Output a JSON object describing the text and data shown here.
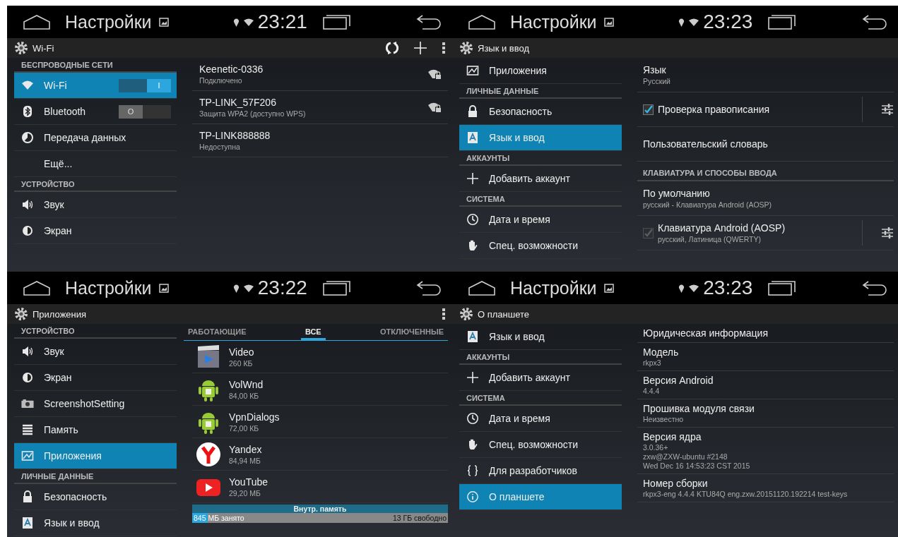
{
  "panels": [
    {
      "status_bar": {
        "title": "Настройки",
        "time": "23:21"
      },
      "action_bar": {
        "title": "Wi-Fi",
        "actions": [
          {
            "kind": "refresh"
          },
          {
            "kind": "add"
          },
          {
            "kind": "menu"
          }
        ]
      },
      "sidebar": [
        {
          "kind": "header",
          "label": "БЕСПРОВОДНЫЕ СЕТИ"
        },
        {
          "kind": "wifi",
          "label": "Wi-Fi",
          "selected": true,
          "toggle": {
            "on": true,
            "text": "I"
          }
        },
        {
          "kind": "bluetooth",
          "label": "Bluetooth",
          "selected": false,
          "toggle": {
            "on": false,
            "text": "O"
          }
        },
        {
          "kind": "data",
          "label": "Передача данных",
          "selected": false
        },
        {
          "kind": "plain",
          "label": "Ещё...",
          "selected": false
        },
        {
          "kind": "header",
          "label": "УСТРОЙСТВО"
        },
        {
          "kind": "sound",
          "label": "Звук",
          "selected": false
        },
        {
          "kind": "display",
          "label": "Экран",
          "selected": false
        }
      ],
      "content": {
        "kind": "networks",
        "networks": [
          {
            "name": "Keenetic-0336",
            "status": "Подключено",
            "in_range": true
          },
          {
            "name": "TP-LINK_57F206",
            "status": "Защита WPA2 (доступно WPS)",
            "in_range": true
          },
          {
            "name": "TP-LINK888888",
            "status": "Недоступна",
            "in_range": false
          }
        ]
      }
    },
    {
      "status_bar": {
        "title": "Настройки",
        "time": "23:23"
      },
      "action_bar": {
        "title": "Язык и ввод"
      },
      "sidebar": [
        {
          "kind": "apps",
          "label": "Приложения",
          "selected": false
        },
        {
          "kind": "header",
          "label": "ЛИЧНЫЕ ДАННЫЕ"
        },
        {
          "kind": "lock",
          "label": "Безопасность",
          "selected": false
        },
        {
          "kind": "language",
          "label": "Язык и ввод",
          "selected": true
        },
        {
          "kind": "header",
          "label": "АККАУНТЫ"
        },
        {
          "kind": "plus",
          "label": "Добавить аккаунт",
          "selected": false
        },
        {
          "kind": "header",
          "label": "СИСТЕМА"
        },
        {
          "kind": "clock",
          "label": "Дата и время",
          "selected": false
        },
        {
          "kind": "hand",
          "label": "Спец. возможности",
          "selected": false
        }
      ],
      "content": {
        "kind": "preferences",
        "items": [
          {
            "kind": "text",
            "title": "Язык",
            "summary": "Русский"
          },
          {
            "kind": "check",
            "title": "Проверка правописания",
            "checked": true,
            "disabled": false,
            "settings": true
          },
          {
            "kind": "text",
            "title": "Пользовательский словарь"
          },
          {
            "kind": "header",
            "title": "КЛАВИАТУРА И СПОСОБЫ ВВОДА"
          },
          {
            "kind": "text",
            "title": "По умолчанию",
            "summary": "русский - Клавиатура Android (AOSP)"
          },
          {
            "kind": "check",
            "title": "Клавиатура Android (AOSP)",
            "summary": "русский, Латиница (QWERTY)",
            "checked": true,
            "disabled": true,
            "settings": true
          }
        ]
      }
    },
    {
      "status_bar": {
        "title": "Настройки",
        "time": "23:22"
      },
      "action_bar": {
        "title": "Приложения",
        "actions": [
          {
            "kind": "menu"
          }
        ]
      },
      "sidebar": [
        {
          "kind": "header",
          "label": "УСТРОЙСТВО"
        },
        {
          "kind": "sound",
          "label": "Звук",
          "selected": false
        },
        {
          "kind": "display",
          "label": "Экран",
          "selected": false
        },
        {
          "kind": "camera",
          "label": "ScreenshotSetting",
          "selected": false
        },
        {
          "kind": "storage",
          "label": "Память",
          "selected": false
        },
        {
          "kind": "apps",
          "label": "Приложения",
          "selected": true
        },
        {
          "kind": "header",
          "label": "ЛИЧНЫЕ ДАННЫЕ"
        },
        {
          "kind": "lock",
          "label": "Безопасность",
          "selected": false
        },
        {
          "kind": "language",
          "label": "Язык и ввод",
          "selected": false
        }
      ],
      "content": {
        "kind": "apps",
        "tabs": [
          {
            "label": "РАБОТАЮЩИЕ",
            "selected": false
          },
          {
            "label": "ВСЕ",
            "selected": true
          },
          {
            "label": "ОТКЛЮЧЕННЫЕ",
            "selected": false
          }
        ],
        "apps": [
          {
            "name": "Video",
            "size": "260 КБ",
            "kind": "video"
          },
          {
            "name": "VolWnd",
            "size": "84,00 КБ",
            "kind": "android"
          },
          {
            "name": "VpnDialogs",
            "size": "72,00 КБ",
            "kind": "android"
          },
          {
            "name": "Yandex",
            "size": "84,94 МБ",
            "kind": "yandex"
          },
          {
            "name": "YouTube",
            "size": "29,20 МБ",
            "kind": "youtube"
          }
        ],
        "storage": {
          "label": "Внутр. память",
          "used": "845 МБ занято",
          "free": "13 ГБ свободно",
          "level": 0.06
        }
      }
    },
    {
      "status_bar": {
        "title": "Настройки",
        "time": "23:23"
      },
      "action_bar": {
        "title": "О планшете"
      },
      "sidebar": [
        {
          "kind": "language",
          "label": "Язык и ввод",
          "selected": false
        },
        {
          "kind": "header",
          "label": "АККАУНТЫ"
        },
        {
          "kind": "plus",
          "label": "Добавить аккаунт",
          "selected": false
        },
        {
          "kind": "header",
          "label": "СИСТЕМА"
        },
        {
          "kind": "clock",
          "label": "Дата и время",
          "selected": false
        },
        {
          "kind": "hand",
          "label": "Спец. возможности",
          "selected": false
        },
        {
          "kind": "braces",
          "label": "Для разработчиков",
          "selected": false
        },
        {
          "kind": "info",
          "label": "О планшете",
          "selected": true
        }
      ],
      "content": {
        "kind": "info",
        "items": [
          {
            "title": "Юридическая информация"
          },
          {
            "title": "Модель",
            "lines": [
              "rkpx3"
            ]
          },
          {
            "title": "Версия Android",
            "lines": [
              "4.4.4"
            ]
          },
          {
            "title": "Прошивка модуля связи",
            "lines": [
              "Неизвестно"
            ]
          },
          {
            "title": "Версия ядра",
            "lines": [
              "3.0.36+",
              "zxw@ZXW-ubuntu #2148",
              "Wed Dec 16 14:53:23 CST 2015"
            ]
          },
          {
            "title": "Номер сборки",
            "lines": [
              "rkpx3-eng 4.4.4 KTU84Q eng.zxw.20151120.192214 test-keys"
            ]
          }
        ]
      }
    }
  ]
}
